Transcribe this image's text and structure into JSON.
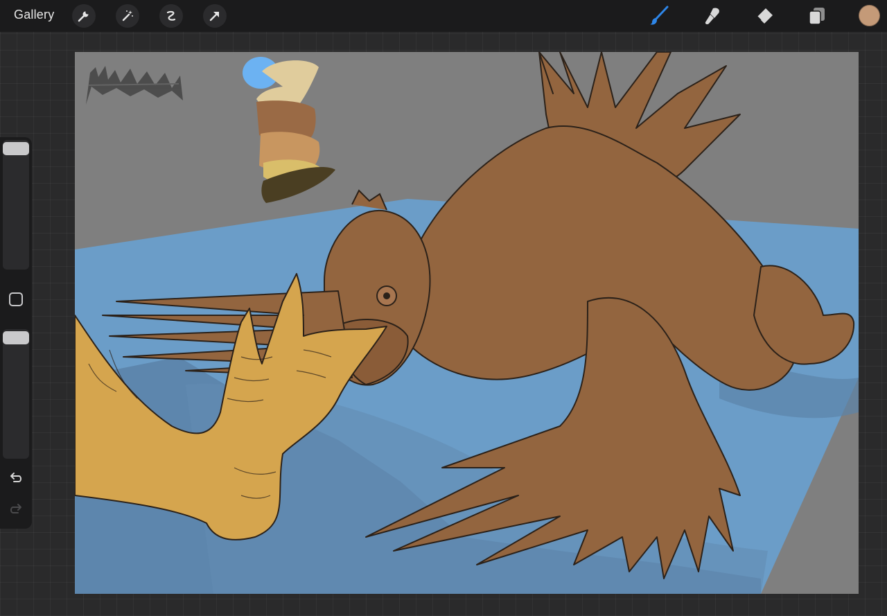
{
  "topbar": {
    "gallery_label": "Gallery",
    "left_tools": [
      "wrench-icon",
      "magic-wand-icon",
      "selection-icon",
      "transform-arrow-icon"
    ],
    "right_tools": [
      "brush-icon",
      "smudge-icon",
      "eraser-icon",
      "layers-icon"
    ],
    "active_tool": "brush-icon",
    "current_color": "#c49a78"
  },
  "sidebar": {
    "brush_size_level": 0.05,
    "opacity_level": 0.05,
    "buttons": [
      "modify-button",
      "undo-button",
      "redo-button"
    ]
  },
  "canvas": {
    "colors": {
      "background_wall": "#7f7f7f",
      "floor": "#6b9dc8",
      "floor_shadow": "#5b83a8",
      "bird_body": "#93653f",
      "foot": "#d5a54e",
      "lineart": "#2b2119",
      "palette": [
        "#6cb2f2",
        "#e0cc9c",
        "#9a6a45",
        "#c89660",
        "#d9be6a",
        "#4a3e22"
      ]
    }
  }
}
